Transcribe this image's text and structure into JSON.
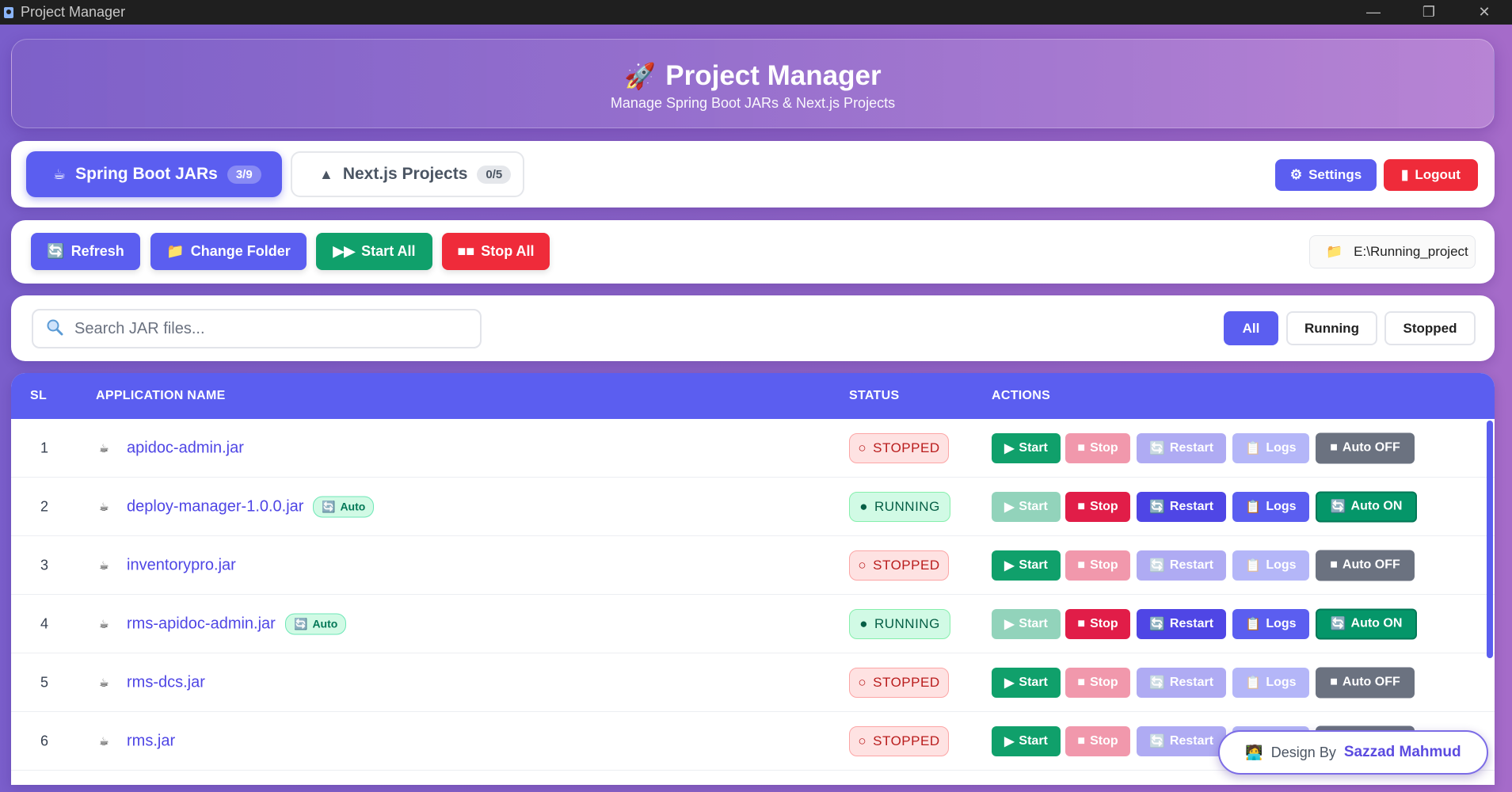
{
  "window": {
    "title": "Project Manager",
    "controls": [
      "—",
      "❐",
      "✕"
    ]
  },
  "header": {
    "icon": "🚀",
    "title": "Project Manager",
    "subtitle": "Manage Spring Boot JARs & Next.js Projects"
  },
  "tabs": [
    {
      "icon": "☕",
      "label": "Spring Boot JARs",
      "count": "3/9"
    },
    {
      "icon": "▲",
      "label": "Next.js Projects",
      "count": "0/5"
    }
  ],
  "top_actions": {
    "settings": "Settings",
    "logout": "Logout"
  },
  "toolbar": {
    "refresh": "Refresh",
    "change_folder": "Change Folder",
    "start_all": "Start All",
    "stop_all": "Stop All",
    "path": "E:\\Running_project"
  },
  "search": {
    "placeholder": "Search JAR files...",
    "value": ""
  },
  "filters": {
    "all": "All",
    "running": "Running",
    "stopped": "Stopped"
  },
  "table": {
    "headers": {
      "sl": "SL",
      "name": "APPLICATION NAME",
      "status": "STATUS",
      "actions": "ACTIONS"
    },
    "action_labels": {
      "start": "Start",
      "stop": "Stop",
      "restart": "Restart",
      "logs": "Logs",
      "auto_on": "Auto ON",
      "auto_off": "Auto OFF",
      "auto_badge": "Auto"
    },
    "rows": [
      {
        "sl": "1",
        "name": "apidoc-admin.jar",
        "status": "STOPPED",
        "auto": false
      },
      {
        "sl": "2",
        "name": "deploy-manager-1.0.0.jar",
        "status": "RUNNING",
        "auto": true
      },
      {
        "sl": "3",
        "name": "inventorypro.jar",
        "status": "STOPPED",
        "auto": false
      },
      {
        "sl": "4",
        "name": "rms-apidoc-admin.jar",
        "status": "RUNNING",
        "auto": true
      },
      {
        "sl": "5",
        "name": "rms-dcs.jar",
        "status": "STOPPED",
        "auto": false
      },
      {
        "sl": "6",
        "name": "rms.jar",
        "status": "STOPPED",
        "auto": false
      }
    ]
  },
  "credit": {
    "icon": "🧑‍💻",
    "prefix": "Design By",
    "author": "Sazzad Mahmud"
  },
  "colors": {
    "primary": "#5b5ef0",
    "success": "#10a06b",
    "danger": "#ef2b3a",
    "neutral": "#6b7280"
  }
}
